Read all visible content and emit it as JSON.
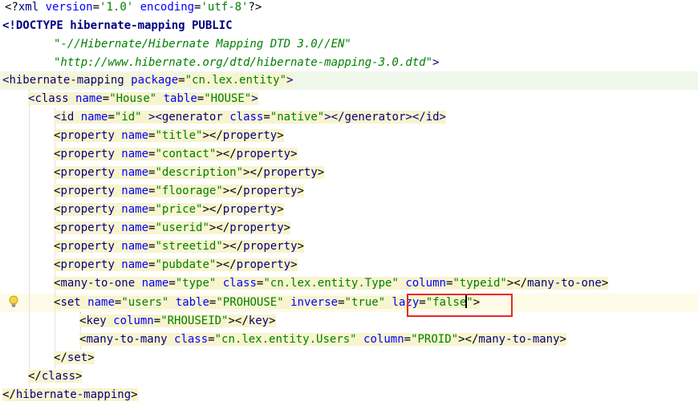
{
  "editor": {
    "line1": {
      "pre": "<?",
      "name": "xml",
      "a1": " version",
      "eq1": "=",
      "v1": "'1.0'",
      "a2": " encoding",
      "eq2": "=",
      "v2": "'utf-8'",
      "post": "?>"
    },
    "line2": {
      "text": "<!DOCTYPE hibernate-mapping PUBLIC"
    },
    "line3": {
      "text": "\"-//Hibernate/Hibernate Mapping DTD 3.0//EN\""
    },
    "line4": {
      "text": "\"http://www.hibernate.org/dtd/hibernate-mapping-3.0.dtd\"",
      "close": ">"
    },
    "line5": {
      "open": "<",
      "name": "hibernate-mapping",
      "attr": " package",
      "eq": "=",
      "val": "\"cn.lex.entity\"",
      "close": ">"
    },
    "line6": {
      "open": "<",
      "name": "class",
      "a1": " name",
      "v1": "\"House\"",
      "a2": " table",
      "v2": "\"HOUSE\"",
      "close": ">"
    },
    "line7": {
      "open": "<",
      "name": "id",
      "a1": " name",
      "v1": "\"id\"",
      "close": ">",
      "open2": "<",
      "name2": "generator",
      "a2": " class",
      "v2": "\"native\"",
      "close2": "></",
      "name3": "generator",
      "close3": "></",
      "name4": "id",
      "close4": ">"
    },
    "properties": [
      {
        "value": "\"title\""
      },
      {
        "value": "\"contact\""
      },
      {
        "value": "\"description\""
      },
      {
        "value": "\"floorage\""
      },
      {
        "value": "\"price\""
      },
      {
        "value": "\"userid\""
      },
      {
        "value": "\"streetid\""
      },
      {
        "value": "\"pubdate\""
      }
    ],
    "property_tag": "property",
    "property_attr": " name",
    "many_to_one": {
      "name": "many-to-one",
      "a1": " name",
      "v1": "\"type\"",
      "a2": " class",
      "v2": "\"cn.lex.entity.Type\"",
      "a3": " column",
      "v3": "\"typeid\"",
      "end": "many-to-one"
    },
    "set": {
      "name": "set",
      "a1": " name",
      "v1": "\"users\"",
      "a2": " table",
      "v2": "\"PROHOUSE\"",
      "a3": " inverse",
      "v3": "\"true\"",
      "a4": " lazy",
      "v4a": "\"false",
      "v4b": "\""
    },
    "key": {
      "name": "key",
      "a1": " column",
      "v1": "\"RHOUSEID\"",
      "end": "key"
    },
    "many_to_many": {
      "name": "many-to-many",
      "a1": " class",
      "v1": "\"cn.lex.entity.Users\"",
      "a2": " column",
      "v2": "\"PROID\"",
      "end": "many-to-many"
    },
    "set_end": "set",
    "class_end": "class",
    "mapping_end": "hibernate-mapping"
  },
  "colors": {
    "highlight_box": "#e8291c",
    "tag_bg": "#f8f4cf",
    "string": "#008000",
    "attribute": "#0000ff",
    "tag": "#000080"
  },
  "icons": {
    "gutter": "lightbulb-icon"
  }
}
